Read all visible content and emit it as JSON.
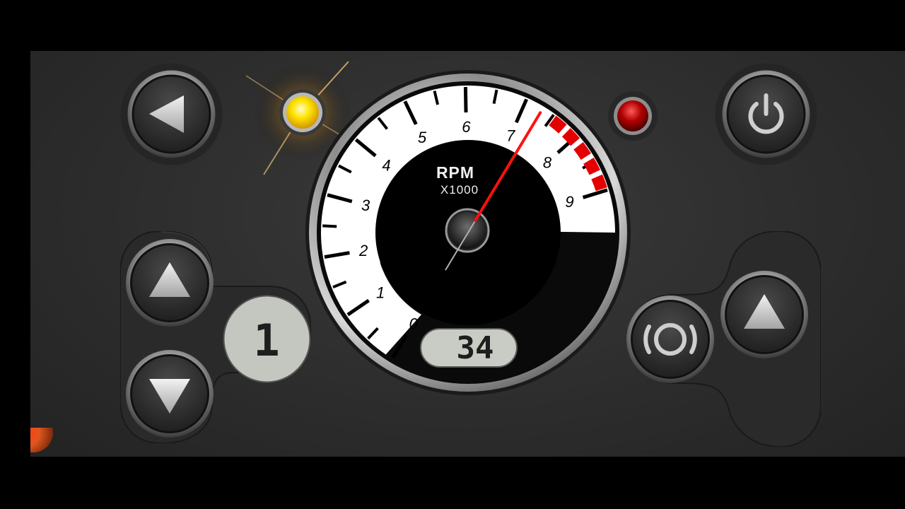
{
  "gauge": {
    "label_top": "RPM",
    "label_bottom": "X1000",
    "scale_labels": [
      "0",
      "1",
      "2",
      "3",
      "4",
      "5",
      "6",
      "7",
      "8",
      "9"
    ],
    "rpm_x1000": 7.3,
    "redline_from": 7.5,
    "speed_display": "34"
  },
  "gear_display": "1",
  "indicators": {
    "left_lamp_color": "#ffd400",
    "left_lamp_state": "on",
    "right_lamp_color": "#b00000",
    "right_lamp_state": "on"
  },
  "buttons": {
    "left_arrow_icon": "triangle-left-icon",
    "power_icon": "power-icon",
    "gear_up_icon": "triangle-up-icon",
    "gear_down_icon": "triangle-down-icon",
    "brake_icon": "brake-icon",
    "throttle_icon": "triangle-up-icon"
  },
  "colors": {
    "redline": "#e30000",
    "needle": "#ff1010",
    "lcd_bg": "#c8ccc4"
  }
}
